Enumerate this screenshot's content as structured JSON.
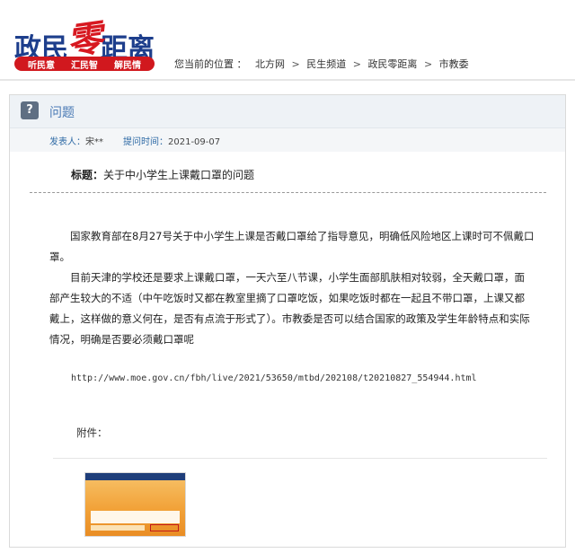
{
  "header": {
    "logo": {
      "part1": "政民",
      "zero": "零",
      "part2": "距离"
    },
    "tags": [
      "听民意",
      "汇民智",
      "解民情"
    ],
    "breadcrumb": {
      "prefix": "您当前的位置 ：",
      "items": [
        "北方网",
        "民生频道",
        "政民零距离",
        "市教委"
      ],
      "separator": ">"
    }
  },
  "question": {
    "section_title": "问题",
    "icon": "question-mark-icon",
    "poster_label": "发表人：",
    "poster": "宋**",
    "time_label": "提问时间：",
    "time": "2021-09-07",
    "subject_label": "标题：",
    "subject": "关于中小学生上课戴口罩的问题",
    "paragraphs": [
      "国家教育部在8月27号关于中小学生上课是否戴口罩给了指导意见，明确低风险地区上课时可不佩戴口罩。",
      "目前天津的学校还是要求上课戴口罩，一天六至八节课，小学生面部肌肤相对较弱，全天戴口罩，面部产生较大的不适（中午吃饭时又都在教室里摘了口罩吃饭，如果吃饭时都在一起且不带口罩，上课又都戴上，这样做的意义何在，是否有点流于形式了）。市教委是否可以结合国家的政策及学生年龄特点和实际情况，明确是否要必须戴口罩呢"
    ],
    "url": "http://www.moe.gov.cn/fbh/live/2021/53650/mtbd/202108/t20210827_554944.html",
    "attachment_label": "附件："
  },
  "colors": {
    "logo_blue": "#1d3e8c",
    "logo_red": "#d71820",
    "tag_bar": "#d1181e",
    "link_blue": "#2e6aa5"
  }
}
